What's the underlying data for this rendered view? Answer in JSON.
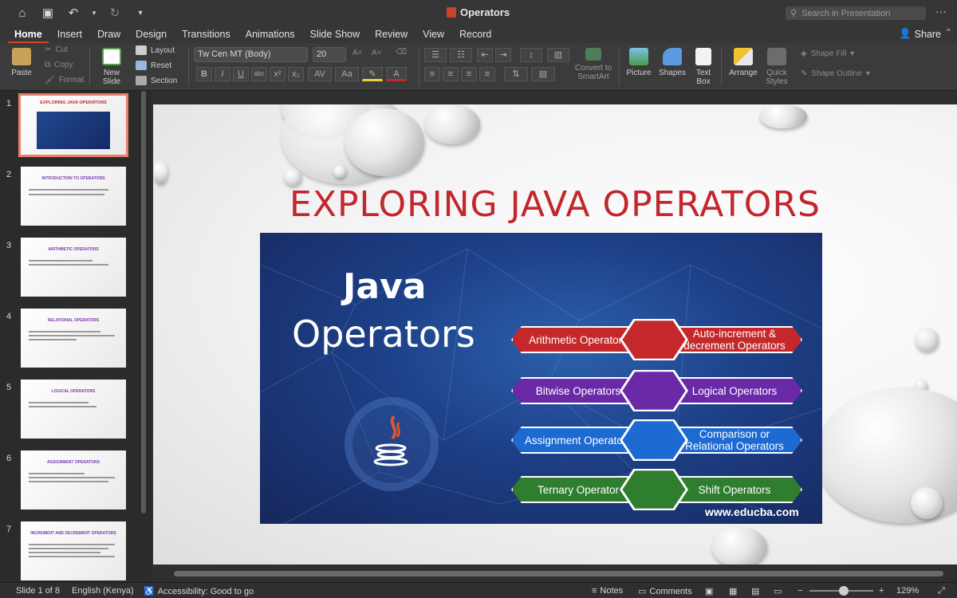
{
  "app": {
    "document_title": "Operators",
    "search_placeholder": "Search in Presentation"
  },
  "tabs": [
    {
      "label": "Home",
      "active": true
    },
    {
      "label": "Insert"
    },
    {
      "label": "Draw"
    },
    {
      "label": "Design"
    },
    {
      "label": "Transitions"
    },
    {
      "label": "Animations"
    },
    {
      "label": "Slide Show"
    },
    {
      "label": "Review"
    },
    {
      "label": "View"
    },
    {
      "label": "Record"
    }
  ],
  "share_label": "Share",
  "ribbon": {
    "paste": "Paste",
    "cut": "Cut",
    "copy": "Copy",
    "format": "Format",
    "new_slide_line1": "New",
    "new_slide_line2": "Slide",
    "layout": "Layout",
    "reset": "Reset",
    "section": "Section",
    "font_name": "Tw Cen MT (Body)",
    "font_size": "20",
    "convert_line1": "Convert to",
    "convert_line2": "SmartArt",
    "picture": "Picture",
    "shapes": "Shapes",
    "textbox_line1": "Text",
    "textbox_line2": "Box",
    "arrange": "Arrange",
    "quick_line1": "Quick",
    "quick_line2": "Styles",
    "shape_fill": "Shape Fill",
    "shape_outline": "Shape Outline"
  },
  "thumbnails": [
    {
      "num": "1",
      "title": "EXPLORING JAVA OPERATORS"
    },
    {
      "num": "2",
      "title": "INTRODUCTION TO OPERATORS"
    },
    {
      "num": "3",
      "title": "ARITHMETIC OPERATORS"
    },
    {
      "num": "4",
      "title": "RELATIONAL OPERATORS"
    },
    {
      "num": "5",
      "title": "LOGICAL OPERATORS"
    },
    {
      "num": "6",
      "title": "ASSIGNMENT OPERATORS"
    },
    {
      "num": "7",
      "title": "INCREMENT AND DECREMENT OPERATORS"
    }
  ],
  "slide": {
    "title": "EXPLORING JAVA OPERATORS",
    "banner": {
      "java": "Java",
      "operators": "Operators",
      "url": "www.educba.com",
      "rows": [
        {
          "left": "Arithmetic Operators",
          "right": "Auto-increment & decrement Operators",
          "color": "#c4282b"
        },
        {
          "left": "Bitwise Operators",
          "right": "Logical Operators",
          "color": "#6a2aa8"
        },
        {
          "left": "Assignment Operators",
          "right": "Comparison or Relational Operators",
          "color": "#1c6ad2"
        },
        {
          "left": "Ternary Operator",
          "right": "Shift Operators",
          "color": "#2f7d2f"
        }
      ]
    }
  },
  "status": {
    "slide_info": "Slide 1 of 8",
    "language": "English (Kenya)",
    "accessibility": "Accessibility: Good to go",
    "notes": "Notes",
    "comments": "Comments",
    "zoom": "129%"
  }
}
